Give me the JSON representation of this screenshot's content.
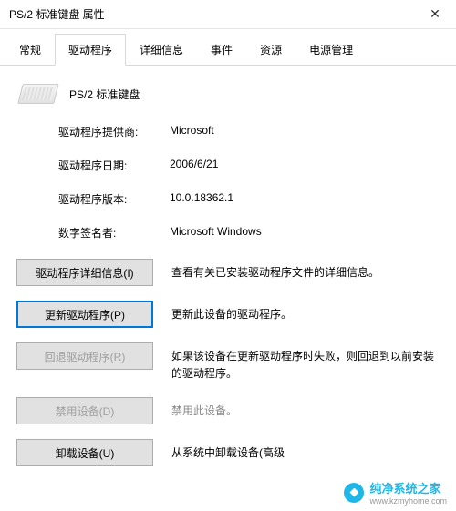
{
  "window": {
    "title": "PS/2 标准键盘 属性"
  },
  "tabs": {
    "general": "常规",
    "driver": "驱动程序",
    "details": "详细信息",
    "events": "事件",
    "resources": "资源",
    "power": "电源管理"
  },
  "device": {
    "name": "PS/2 标准键盘"
  },
  "info": {
    "provider_label": "驱动程序提供商:",
    "provider_value": "Microsoft",
    "date_label": "驱动程序日期:",
    "date_value": "2006/6/21",
    "version_label": "驱动程序版本:",
    "version_value": "10.0.18362.1",
    "signer_label": "数字签名者:",
    "signer_value": "Microsoft Windows"
  },
  "actions": {
    "details_btn": "驱动程序详细信息(I)",
    "details_desc": "查看有关已安装驱动程序文件的详细信息。",
    "update_btn": "更新驱动程序(P)",
    "update_desc": "更新此设备的驱动程序。",
    "rollback_btn": "回退驱动程序(R)",
    "rollback_desc": "如果该设备在更新驱动程序时失败，则回退到以前安装的驱动程序。",
    "disable_btn": "禁用设备(D)",
    "disable_desc": "禁用此设备。",
    "uninstall_btn": "卸载设备(U)",
    "uninstall_desc": "从系统中卸载设备(高级"
  },
  "watermark": {
    "text": "纯净系统之家",
    "url": "www.kzmyhome.com"
  }
}
